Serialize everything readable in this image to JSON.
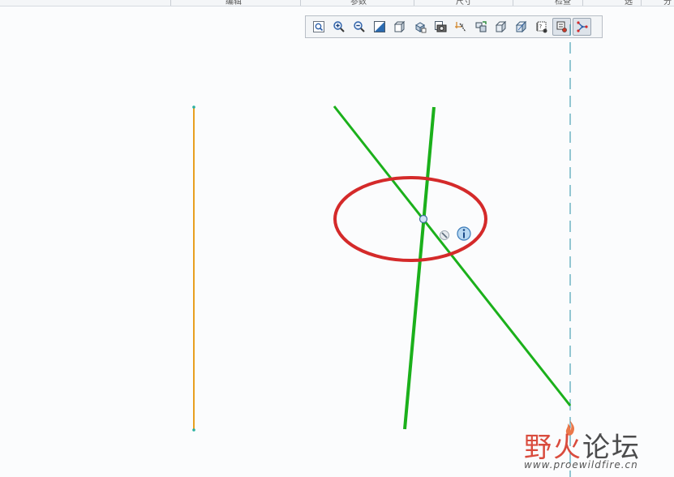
{
  "top_tabs": [
    "编辑",
    "参数",
    "尺寸",
    "检查",
    "选",
    "分"
  ],
  "toolbar": {
    "buttons": [
      {
        "name": "refit-icon",
        "active": false
      },
      {
        "name": "zoom-in-icon",
        "active": false
      },
      {
        "name": "zoom-out-icon",
        "active": false
      },
      {
        "name": "repaint-icon",
        "active": false
      },
      {
        "name": "display-style-icon",
        "active": false
      },
      {
        "name": "saved-views-icon",
        "active": false
      },
      {
        "name": "view-manager-icon",
        "active": false
      },
      {
        "name": "sketch-view-icon",
        "active": false
      },
      {
        "name": "datum-display-icon",
        "active": false
      },
      {
        "name": "spin-center-icon",
        "active": false
      },
      {
        "name": "orient-icon",
        "active": false
      },
      {
        "name": "annotation-display-icon",
        "active": false
      },
      {
        "name": "sketcher-display-icon",
        "active": true
      },
      {
        "name": "constraint-display-icon",
        "active": true
      }
    ]
  },
  "canvas": {
    "colors": {
      "construction_line": "#e8a020",
      "sketch_line": "#1bb01b",
      "highlight_ellipse": "#d42a2a",
      "centerline": "#2a8fa8"
    },
    "popup_icons": [
      "wrench-icon",
      "info-icon"
    ]
  },
  "watermark": {
    "logo_red": "野火",
    "logo_dark": "论坛",
    "url": "www.proewildfire.cn"
  }
}
